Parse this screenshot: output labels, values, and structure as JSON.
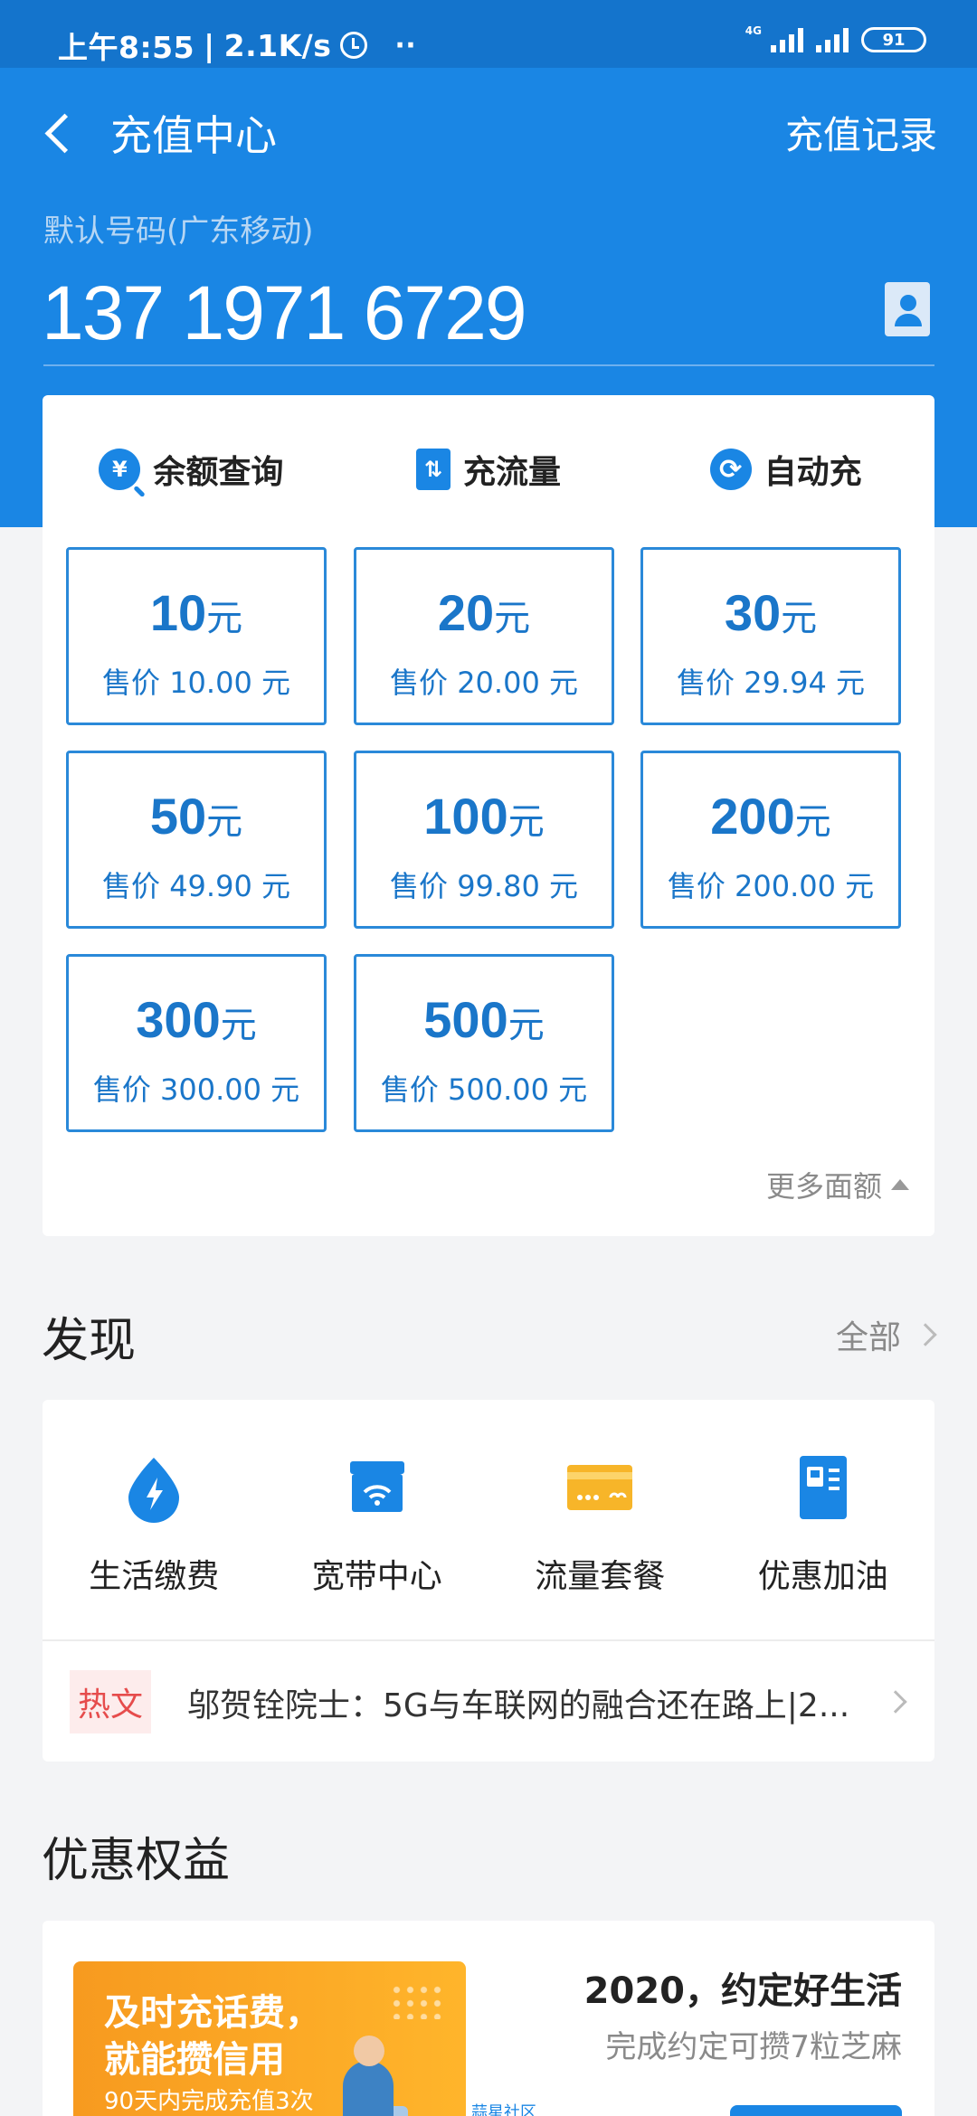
{
  "status_bar": {
    "time": "上午8:55",
    "speed": "2.1K/s",
    "more": "··",
    "network": "4G",
    "battery": "91"
  },
  "header": {
    "title": "充值中心",
    "history_link": "充值记录"
  },
  "phone": {
    "label": "默认号码(广东移动)",
    "number": "137 1971 6729"
  },
  "quick_actions": [
    {
      "label": "余额查询",
      "icon": "balance-query-icon",
      "glyph": "¥"
    },
    {
      "label": "充流量",
      "icon": "data-recharge-icon",
      "glyph": "⇅"
    },
    {
      "label": "自动充",
      "icon": "auto-recharge-icon",
      "glyph": "⟳"
    }
  ],
  "amounts": [
    {
      "value": "10",
      "unit": "元",
      "price": "售价 10.00 元"
    },
    {
      "value": "20",
      "unit": "元",
      "price": "售价 20.00 元"
    },
    {
      "value": "30",
      "unit": "元",
      "price": "售价 29.94 元"
    },
    {
      "value": "50",
      "unit": "元",
      "price": "售价 49.90 元"
    },
    {
      "value": "100",
      "unit": "元",
      "price": "售价 99.80 元"
    },
    {
      "value": "200",
      "unit": "元",
      "price": "售价 200.00 元"
    },
    {
      "value": "300",
      "unit": "元",
      "price": "售价 300.00 元"
    },
    {
      "value": "500",
      "unit": "元",
      "price": "售价 500.00 元"
    }
  ],
  "more_amounts": "更多面额",
  "discover": {
    "title": "发现",
    "all_link": "全部",
    "services": [
      {
        "label": "生活缴费",
        "icon": "utility-bill-icon"
      },
      {
        "label": "宽带中心",
        "icon": "broadband-icon"
      },
      {
        "label": "流量套餐",
        "icon": "data-package-icon"
      },
      {
        "label": "优惠加油",
        "icon": "fuel-icon"
      }
    ],
    "news": {
      "badge": "热文",
      "text": "邬贺铨院士：5G与车联网的融合还在路上|2..."
    }
  },
  "benefits": {
    "title": "优惠权益",
    "banner_line1": "及时充话费，",
    "banner_line2": "就能攒信用",
    "banner_line3": "90天内完成充值3次",
    "banner_corner": "蒜星社区",
    "promo_title": "2020，约定好生活",
    "promo_sub": "完成约定可攒7粒芝麻"
  },
  "colors": {
    "primary": "#1a86e4",
    "status_bar": "#1474cc",
    "accent_orange": "#f7a21f",
    "hot_red": "#e64c4c"
  }
}
